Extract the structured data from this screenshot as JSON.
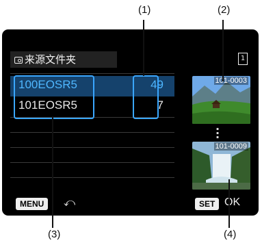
{
  "callouts": {
    "c1": "(1)",
    "c2": "(2)",
    "c3": "(3)",
    "c4": "(4)"
  },
  "header": {
    "title": "来源文件夹",
    "folder_icon": "folder-image-icon",
    "card_icon": "memory-card-icon",
    "card_number": "1"
  },
  "folders": [
    {
      "name": "100EOSR5",
      "count": "49",
      "selected": true
    },
    {
      "name": "101EOSR5",
      "count": "7",
      "selected": false
    }
  ],
  "thumbnails": [
    {
      "label": "101-0003",
      "scene": "meadow-cabin"
    },
    {
      "label": "101-0009",
      "scene": "waterfall"
    }
  ],
  "footer": {
    "menu_label": "MENU",
    "menu_icon": "return-arrow-icon",
    "set_label": "SET",
    "ok_label": "OK"
  },
  "colors": {
    "screen_bg": "#000000",
    "selection": "#15426c",
    "selected_text": "#4fb7ff",
    "highlight_border": "#3aa7ff"
  }
}
